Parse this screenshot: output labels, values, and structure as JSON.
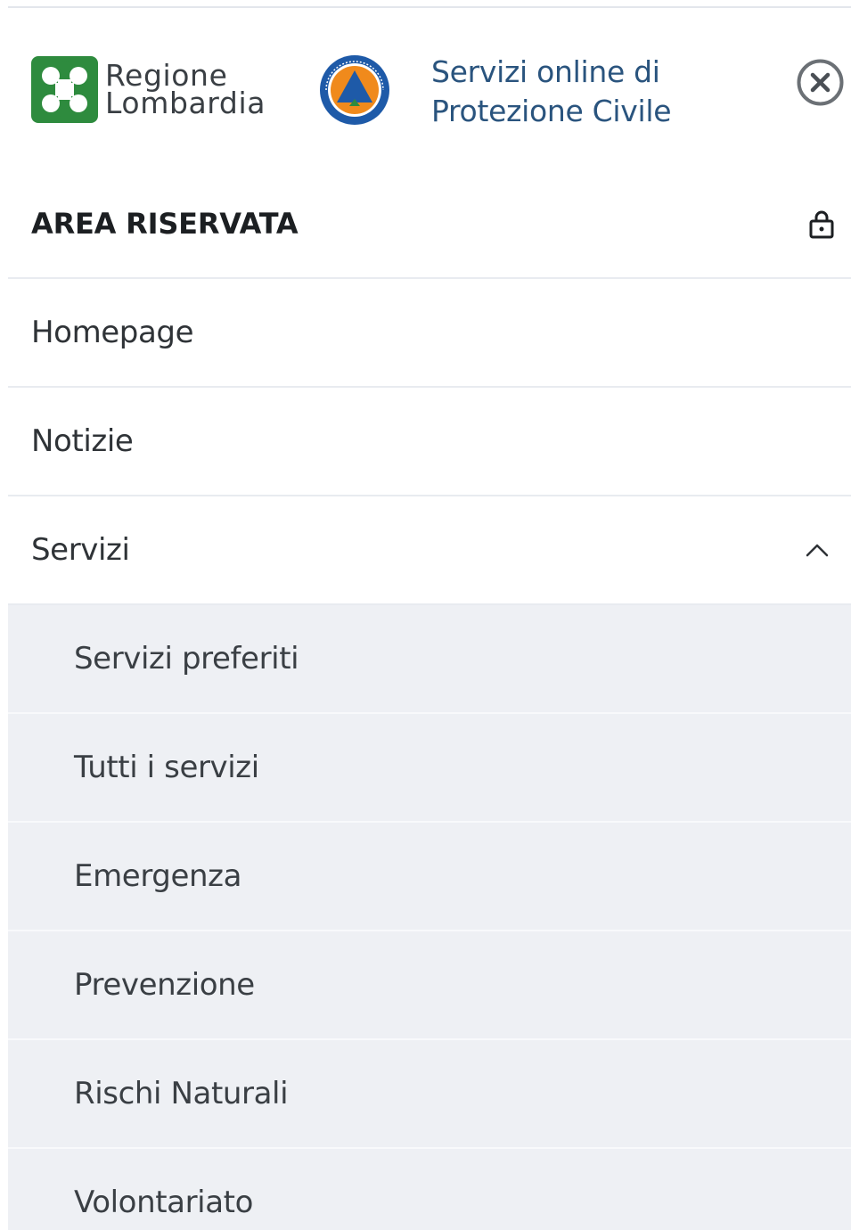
{
  "header": {
    "org_name_line1": "Regione",
    "org_name_line2": "Lombardia",
    "service_title_line1": "Servizi online di",
    "service_title_line2": "Protezione Civile",
    "close_icon": "close-circle-icon",
    "pc_logo_text": "Protezione Civile"
  },
  "menu": {
    "reserved": {
      "label": "AREA RISERVATA",
      "icon": "lock-icon"
    },
    "items": [
      {
        "label": "Homepage"
      },
      {
        "label": "Notizie"
      },
      {
        "label": "Servizi",
        "icon": "chevron-up-icon",
        "expanded": true
      }
    ],
    "servizi_submenu": [
      {
        "label": "Servizi preferiti"
      },
      {
        "label": "Tutti i servizi"
      },
      {
        "label": "Emergenza"
      },
      {
        "label": "Prevenzione"
      },
      {
        "label": "Rischi Naturali"
      },
      {
        "label": "Volontariato"
      }
    ]
  },
  "colors": {
    "brand_green": "#2e8b3e",
    "title_blue": "#2a547e",
    "submenu_bg": "#eef0f4",
    "divider": "#e8ebf0"
  }
}
